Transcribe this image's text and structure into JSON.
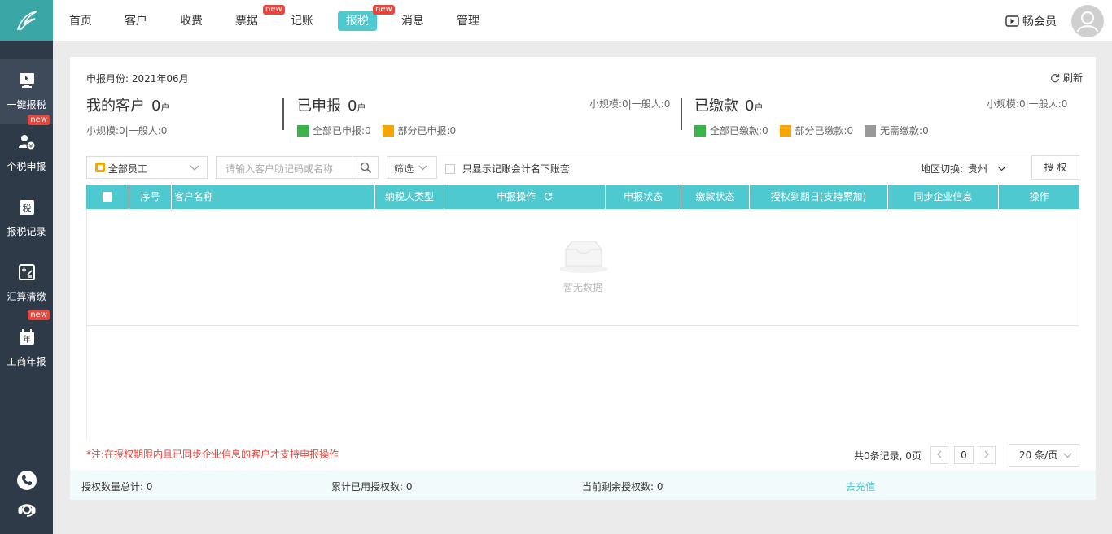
{
  "sidebar": {
    "items": [
      {
        "label": "一键报税",
        "icon": "monitor-icon",
        "active": true,
        "badge": ""
      },
      {
        "label": "个税申报",
        "icon": "person-tax-icon",
        "active": false,
        "badge": "new"
      },
      {
        "label": "报税记录",
        "icon": "tax-record-icon",
        "active": false,
        "badge": ""
      },
      {
        "label": "汇算清缴",
        "icon": "calc-icon",
        "active": false,
        "badge": ""
      },
      {
        "label": "工商年报",
        "icon": "calendar-icon",
        "active": false,
        "badge": "new"
      }
    ]
  },
  "topnav": {
    "items": [
      {
        "label": "首页",
        "badge": ""
      },
      {
        "label": "客户",
        "badge": ""
      },
      {
        "label": "收费",
        "badge": ""
      },
      {
        "label": "票据",
        "badge": "new"
      },
      {
        "label": "记账",
        "badge": ""
      },
      {
        "label": "报税",
        "badge": "new",
        "active": true
      },
      {
        "label": "消息",
        "badge": ""
      },
      {
        "label": "管理",
        "badge": ""
      }
    ],
    "vip_label": "畅会员"
  },
  "header": {
    "period": "申报月份: 2021年06月",
    "refresh": "刷新"
  },
  "stats": {
    "customers": {
      "title": "我的客户",
      "count": "0",
      "unit": "户",
      "sub": "小规模:0|一般人:0"
    },
    "declared": {
      "title": "已申报",
      "count": "0",
      "unit": "户",
      "sub": "小规模:0|一般人:0",
      "legend": [
        "全部已申报:0",
        "部分已申报:0"
      ]
    },
    "paid": {
      "title": "已缴款",
      "count": "0",
      "unit": "户",
      "sub": "小规模:0|一般人:0",
      "legend": [
        "全部已缴款:0",
        "部分已缴款:0",
        "无需缴款:0"
      ]
    }
  },
  "colors": {
    "accent": "#4ec9cf",
    "green": "#3bb54a",
    "orange": "#f6a600",
    "gray": "#999999",
    "red": "#e8453c"
  },
  "filters": {
    "staff_select": "全部员工",
    "search_placeholder": "请输入客户助记码或名称",
    "filter_label": "筛选",
    "only_show_label": "只显示记账会计名下账套",
    "region_label": "地区切换:",
    "region_value": "贵州",
    "authorize_button": "授 权"
  },
  "table": {
    "headers": [
      "序号",
      "客户名称",
      "纳税人类型",
      "申报操作",
      "申报状态",
      "缴款状态",
      "授权到期日(支持累加)",
      "同步企业信息",
      "操作"
    ],
    "empty_text": "暂无数据"
  },
  "notice": "*注:在授权期限内且已同步企业信息的客户才支持申报操作",
  "pager": {
    "summary": "共0条记录, 0页",
    "current": "0",
    "page_size": "20 条/页"
  },
  "footer": {
    "total": "授权数量总计: 0",
    "used": "累计已用授权数: 0",
    "remaining": "当前剩余授权数: 0",
    "recharge": "去充值"
  }
}
